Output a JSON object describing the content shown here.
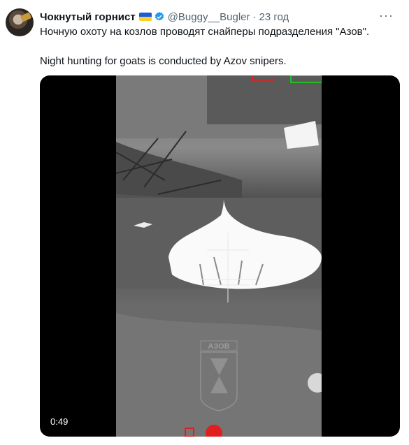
{
  "tweet": {
    "author_name": "Чокнутый горнист",
    "handle": "@Buggy__Bugler",
    "separator": "·",
    "time": "23 год",
    "more_label": "···",
    "text_ru": "Ночную охоту на козлов проводят снайперы подразделения \"Азов\".",
    "text_en": "Night hunting for goats is conducted by Azov snipers."
  },
  "video": {
    "duration": "0:49",
    "watermark_text": "АЗОВ"
  },
  "colors": {
    "flag_blue": "#1d5bd6",
    "flag_yellow": "#f7d02c",
    "verified": "#1d9bf0"
  }
}
